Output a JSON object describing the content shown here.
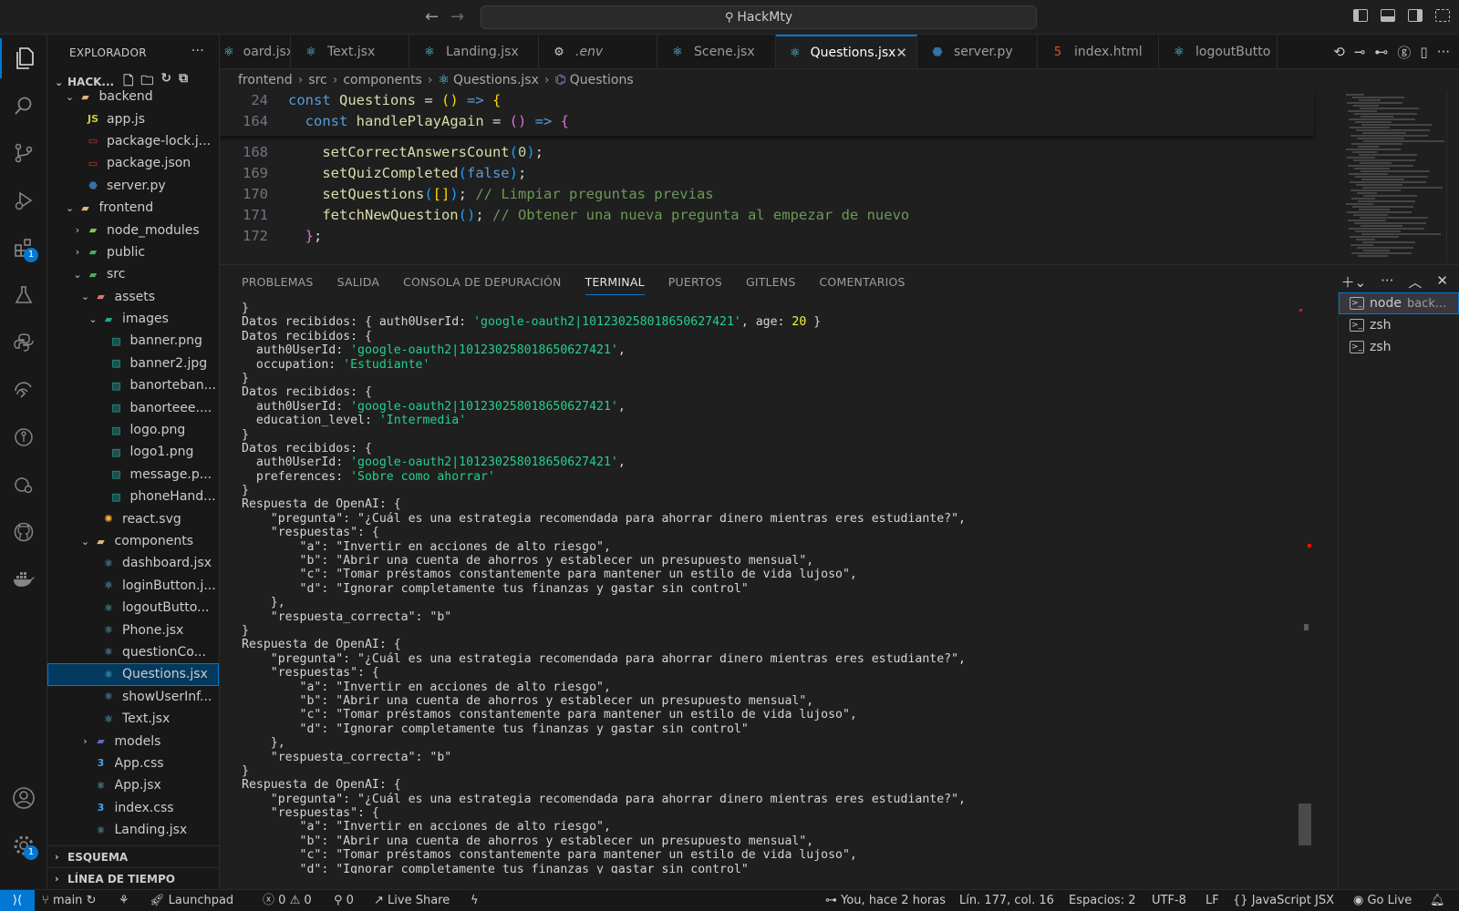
{
  "titlebar": {
    "search_text": "HackMty",
    "back_icon": "←",
    "forward_icon": "→"
  },
  "activity_bar": {
    "badges": {
      "extensions": "1",
      "settings": "1"
    }
  },
  "sidebar": {
    "title": "EXPLORADOR",
    "more": "···",
    "project": "HACK...",
    "tree": [
      {
        "label": "backend",
        "depth": 1,
        "chev": "⌄",
        "icon": "folder-open",
        "color": "#dcb67a"
      },
      {
        "label": "app.js",
        "depth": 2,
        "chev": "",
        "icon": "js",
        "color": "#cbcb41"
      },
      {
        "label": "package-lock.j...",
        "depth": 2,
        "chev": "",
        "icon": "npm",
        "color": "#cb3837"
      },
      {
        "label": "package.json",
        "depth": 2,
        "chev": "",
        "icon": "npm",
        "color": "#cb3837"
      },
      {
        "label": "server.py",
        "depth": 2,
        "chev": "",
        "icon": "python",
        "color": "#3572a5"
      },
      {
        "label": "frontend",
        "depth": 1,
        "chev": "⌄",
        "icon": "folder-open",
        "color": "#dcb67a"
      },
      {
        "label": "node_modules",
        "depth": 2,
        "chev": "›",
        "icon": "folder-node",
        "color": "#8bc34a"
      },
      {
        "label": "public",
        "depth": 2,
        "chev": "›",
        "icon": "folder-public",
        "color": "#4caf50"
      },
      {
        "label": "src",
        "depth": 2,
        "chev": "⌄",
        "icon": "folder-src",
        "color": "#4caf50"
      },
      {
        "label": "assets",
        "depth": 3,
        "chev": "⌄",
        "icon": "folder-assets",
        "color": "#e57373"
      },
      {
        "label": "images",
        "depth": 4,
        "chev": "⌄",
        "icon": "folder-images",
        "color": "#26a69a"
      },
      {
        "label": "banner.png",
        "depth": 5,
        "chev": "",
        "icon": "image",
        "color": "#26a69a"
      },
      {
        "label": "banner2.jpg",
        "depth": 5,
        "chev": "",
        "icon": "image",
        "color": "#26a69a"
      },
      {
        "label": "banorteban...",
        "depth": 5,
        "chev": "",
        "icon": "image",
        "color": "#26a69a"
      },
      {
        "label": "banorteee....",
        "depth": 5,
        "chev": "",
        "icon": "image",
        "color": "#26a69a"
      },
      {
        "label": "logo.png",
        "depth": 5,
        "chev": "",
        "icon": "image",
        "color": "#26a69a"
      },
      {
        "label": "logo1.png",
        "depth": 5,
        "chev": "",
        "icon": "image",
        "color": "#26a69a"
      },
      {
        "label": "message.p...",
        "depth": 5,
        "chev": "",
        "icon": "image",
        "color": "#26a69a"
      },
      {
        "label": "phoneHand...",
        "depth": 5,
        "chev": "",
        "icon": "image",
        "color": "#26a69a"
      },
      {
        "label": "react.svg",
        "depth": 4,
        "chev": "",
        "icon": "svg",
        "color": "#ffb13b"
      },
      {
        "label": "components",
        "depth": 3,
        "chev": "⌄",
        "icon": "folder-components",
        "color": "#dcb67a"
      },
      {
        "label": "dashboard.jsx",
        "depth": 4,
        "chev": "",
        "icon": "react",
        "color": "#61dafb"
      },
      {
        "label": "loginButton.j...",
        "depth": 4,
        "chev": "",
        "icon": "react",
        "color": "#61dafb"
      },
      {
        "label": "logoutButto...",
        "depth": 4,
        "chev": "",
        "icon": "react",
        "color": "#61dafb"
      },
      {
        "label": "Phone.jsx",
        "depth": 4,
        "chev": "",
        "icon": "react",
        "color": "#61dafb"
      },
      {
        "label": "questionCo...",
        "depth": 4,
        "chev": "",
        "icon": "react",
        "color": "#61dafb"
      },
      {
        "label": "Questions.jsx",
        "depth": 4,
        "chev": "",
        "icon": "react",
        "color": "#61dafb",
        "selected": true
      },
      {
        "label": "showUserInf...",
        "depth": 4,
        "chev": "",
        "icon": "react",
        "color": "#61dafb"
      },
      {
        "label": "Text.jsx",
        "depth": 4,
        "chev": "",
        "icon": "react",
        "color": "#61dafb"
      },
      {
        "label": "models",
        "depth": 3,
        "chev": "›",
        "icon": "folder-models",
        "color": "#5c6bc0"
      },
      {
        "label": "App.css",
        "depth": 3,
        "chev": "",
        "icon": "css",
        "color": "#42a5f5"
      },
      {
        "label": "App.jsx",
        "depth": 3,
        "chev": "",
        "icon": "react",
        "color": "#61dafb"
      },
      {
        "label": "index.css",
        "depth": 3,
        "chev": "",
        "icon": "css",
        "color": "#42a5f5"
      },
      {
        "label": "Landing.jsx",
        "depth": 3,
        "chev": "",
        "icon": "react",
        "color": "#61dafb"
      }
    ],
    "outline": "ESQUEMA",
    "timeline": "LÍNEA DE TIEMPO"
  },
  "tabs": [
    {
      "label": "oard.jsx",
      "icon": "react",
      "active": false
    },
    {
      "label": "Text.jsx",
      "icon": "react",
      "active": false
    },
    {
      "label": "Landing.jsx",
      "icon": "react",
      "active": false
    },
    {
      "label": ".env",
      "icon": "gear",
      "active": false
    },
    {
      "label": "Scene.jsx",
      "icon": "react",
      "active": false
    },
    {
      "label": "Questions.jsx",
      "icon": "react",
      "active": true
    },
    {
      "label": "server.py",
      "icon": "python",
      "active": false
    },
    {
      "label": "index.html",
      "icon": "html",
      "active": false
    },
    {
      "label": "logoutButto",
      "icon": "react",
      "active": false
    }
  ],
  "breadcrumb": [
    "frontend",
    "src",
    "components",
    "Questions.jsx",
    "Questions"
  ],
  "editor": {
    "sticky": [
      {
        "ln": "24",
        "indent": "",
        "parts": [
          [
            "kw",
            "const "
          ],
          [
            "fn",
            "Questions "
          ],
          [
            "pn",
            "= "
          ],
          [
            "br1",
            "()"
          ],
          [
            "kw",
            " => "
          ],
          [
            "br1",
            "{"
          ]
        ]
      },
      {
        "ln": "164",
        "indent": "  ",
        "parts": [
          [
            "kw",
            "const "
          ],
          [
            "fn",
            "handlePlayAgain "
          ],
          [
            "pn",
            "= "
          ],
          [
            "br2",
            "()"
          ],
          [
            "kw",
            " => "
          ],
          [
            "br2",
            "{"
          ]
        ]
      }
    ],
    "lines": [
      {
        "ln": "168",
        "indent": "    ",
        "parts": [
          [
            "fn",
            "setCorrectAnswersCount"
          ],
          [
            "br3",
            "("
          ],
          [
            "num",
            "0"
          ],
          [
            "br3",
            ")"
          ],
          [
            "pn",
            ";"
          ]
        ]
      },
      {
        "ln": "169",
        "indent": "    ",
        "parts": [
          [
            "fn",
            "setQuizCompleted"
          ],
          [
            "br3",
            "("
          ],
          [
            "kw",
            "false"
          ],
          [
            "br3",
            ")"
          ],
          [
            "pn",
            ";"
          ]
        ]
      },
      {
        "ln": "170",
        "indent": "    ",
        "parts": [
          [
            "fn",
            "setQuestions"
          ],
          [
            "br3",
            "("
          ],
          [
            "br1",
            "[]"
          ],
          [
            "br3",
            ")"
          ],
          [
            "pn",
            "; "
          ],
          [
            "cm",
            "// Limpiar preguntas previas"
          ]
        ]
      },
      {
        "ln": "171",
        "indent": "    ",
        "parts": [
          [
            "fn",
            "fetchNewQuestion"
          ],
          [
            "br3",
            "()"
          ],
          [
            "pn",
            "; "
          ],
          [
            "cm",
            "// Obtener una nueva pregunta al empezar de nuevo"
          ]
        ]
      },
      {
        "ln": "172",
        "indent": "  ",
        "parts": [
          [
            "br2",
            "}"
          ],
          [
            "pn",
            ";"
          ]
        ]
      }
    ]
  },
  "panel": {
    "tabs": [
      "PROBLEMAS",
      "SALIDA",
      "CONSOLA DE DEPURACIÓN",
      "TERMINAL",
      "PUERTOS",
      "GITLENS",
      "COMENTARIOS"
    ],
    "active_tab": "TERMINAL",
    "terminal_lines": [
      [
        [
          "p",
          "}"
        ]
      ],
      [
        [
          "p",
          "Datos recibidos: { auth0UserId: "
        ],
        [
          "s",
          "'google-oauth2|101230258018650627421'"
        ],
        [
          "p",
          ", age: "
        ],
        [
          "n",
          "20"
        ],
        [
          "p",
          " }"
        ]
      ],
      [
        [
          "p",
          "Datos recibidos: {"
        ]
      ],
      [
        [
          "p",
          "  auth0UserId: "
        ],
        [
          "s",
          "'google-oauth2|101230258018650627421'"
        ],
        [
          "p",
          ","
        ]
      ],
      [
        [
          "p",
          "  occupation: "
        ],
        [
          "s",
          "'Estudiante'"
        ]
      ],
      [
        [
          "p",
          "}"
        ]
      ],
      [
        [
          "p",
          "Datos recibidos: {"
        ]
      ],
      [
        [
          "p",
          "  auth0UserId: "
        ],
        [
          "s",
          "'google-oauth2|101230258018650627421'"
        ],
        [
          "p",
          ","
        ]
      ],
      [
        [
          "p",
          "  education_level: "
        ],
        [
          "s",
          "'Intermedia'"
        ]
      ],
      [
        [
          "p",
          "}"
        ]
      ],
      [
        [
          "p",
          "Datos recibidos: {"
        ]
      ],
      [
        [
          "p",
          "  auth0UserId: "
        ],
        [
          "s",
          "'google-oauth2|101230258018650627421'"
        ],
        [
          "p",
          ","
        ]
      ],
      [
        [
          "p",
          "  preferences: "
        ],
        [
          "s",
          "'Sobre como ahorrar'"
        ]
      ],
      [
        [
          "p",
          "}"
        ]
      ],
      [
        [
          "p",
          "Respuesta de OpenAI: {"
        ]
      ],
      [
        [
          "p",
          "    \"pregunta\": \"¿Cuál es una estrategia recomendada para ahorrar dinero mientras eres estudiante?\","
        ]
      ],
      [
        [
          "p",
          "    \"respuestas\": {"
        ]
      ],
      [
        [
          "p",
          "        \"a\": \"Invertir en acciones de alto riesgo\","
        ]
      ],
      [
        [
          "p",
          "        \"b\": \"Abrir una cuenta de ahorros y establecer un presupuesto mensual\","
        ]
      ],
      [
        [
          "p",
          "        \"c\": \"Tomar préstamos constantemente para mantener un estilo de vida lujoso\","
        ]
      ],
      [
        [
          "p",
          "        \"d\": \"Ignorar completamente tus finanzas y gastar sin control\""
        ]
      ],
      [
        [
          "p",
          "    },"
        ]
      ],
      [
        [
          "p",
          "    \"respuesta_correcta\": \"b\""
        ]
      ],
      [
        [
          "p",
          "}"
        ]
      ],
      [
        [
          "p",
          "Respuesta de OpenAI: {"
        ]
      ],
      [
        [
          "p",
          "    \"pregunta\": \"¿Cuál es una estrategia recomendada para ahorrar dinero mientras eres estudiante?\","
        ]
      ],
      [
        [
          "p",
          "    \"respuestas\": {"
        ]
      ],
      [
        [
          "p",
          "        \"a\": \"Invertir en acciones de alto riesgo\","
        ]
      ],
      [
        [
          "p",
          "        \"b\": \"Abrir una cuenta de ahorros y establecer un presupuesto mensual\","
        ]
      ],
      [
        [
          "p",
          "        \"c\": \"Tomar préstamos constantemente para mantener un estilo de vida lujoso\","
        ]
      ],
      [
        [
          "p",
          "        \"d\": \"Ignorar completamente tus finanzas y gastar sin control\""
        ]
      ],
      [
        [
          "p",
          "    },"
        ]
      ],
      [
        [
          "p",
          "    \"respuesta_correcta\": \"b\""
        ]
      ],
      [
        [
          "p",
          "}"
        ]
      ],
      [
        [
          "p",
          "Respuesta de OpenAI: {"
        ]
      ],
      [
        [
          "p",
          "    \"pregunta\": \"¿Cuál es una estrategia recomendada para ahorrar dinero mientras eres estudiante?\","
        ]
      ],
      [
        [
          "p",
          "    \"respuestas\": {"
        ]
      ],
      [
        [
          "p",
          "        \"a\": \"Invertir en acciones de alto riesgo\","
        ]
      ],
      [
        [
          "p",
          "        \"b\": \"Abrir una cuenta de ahorros y establecer un presupuesto mensual\","
        ]
      ],
      [
        [
          "p",
          "        \"c\": \"Tomar préstamos constantemente para mantener un estilo de vida lujoso\","
        ]
      ],
      [
        [
          "p",
          "        \"d\": \"Ignorar completamente tus finanzas y gastar sin control\""
        ]
      ]
    ],
    "terminals": [
      {
        "name": "node",
        "sub": "back...",
        "active": true
      },
      {
        "name": "zsh",
        "sub": "",
        "active": false
      },
      {
        "name": "zsh",
        "sub": "",
        "active": false
      }
    ]
  },
  "statusbar": {
    "branch": "main",
    "launchpad": "Launchpad",
    "errors": "0",
    "warnings": "0",
    "ports": "0",
    "live_share": "Live Share",
    "blame": "You, hace 2 horas",
    "position": "Lín. 177, col. 16",
    "spaces": "Espacios: 2",
    "encoding": "UTF-8",
    "eol": "LF",
    "language": "JavaScript JSX",
    "go_live": "Go Live"
  },
  "colors": {
    "accent": "#0078d4",
    "selection": "#04395e",
    "terminal_string": "#23d18b",
    "terminal_number": "#f5f543"
  }
}
